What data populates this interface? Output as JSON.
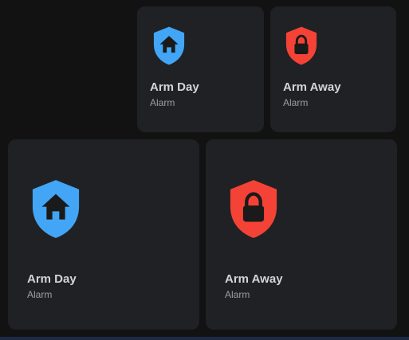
{
  "tiles": [
    {
      "title": "Arm Day",
      "subtitle": "Alarm",
      "icon": "shield-home-icon",
      "color": "#42a5f5"
    },
    {
      "title": "Arm Away",
      "subtitle": "Alarm",
      "icon": "shield-lock-icon",
      "color": "#f44336"
    },
    {
      "title": "Arm Day",
      "subtitle": "Alarm",
      "icon": "shield-home-icon",
      "color": "#42a5f5"
    },
    {
      "title": "Arm Away",
      "subtitle": "Alarm",
      "icon": "shield-lock-icon",
      "color": "#f44336"
    }
  ]
}
